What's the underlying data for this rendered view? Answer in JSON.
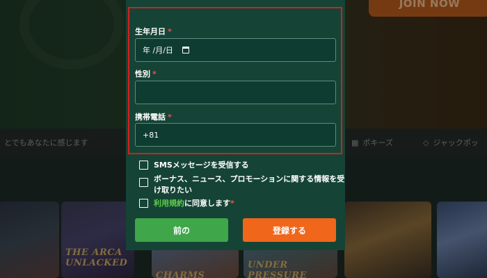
{
  "background": {
    "join_button": "JOIN NOW",
    "strip_left": "とでもあなたに感じます",
    "strip_poker": "ポキーズ",
    "strip_jackpot": "ジャックポッ",
    "tiles": [
      {
        "title": "THE ARCA UNLACKED"
      },
      {
        "title": "CHARMS"
      },
      {
        "title": "UNDER PRESSURE"
      }
    ]
  },
  "form": {
    "birthdate": {
      "label": "生年月日",
      "required_mark": "*",
      "value": "年 /月/日"
    },
    "gender": {
      "label": "性別",
      "required_mark": "*",
      "value": ""
    },
    "phone": {
      "label": "携帯電話",
      "required_mark": "*",
      "value": "+81"
    }
  },
  "checkboxes": {
    "sms": {
      "label": "SMSメッセージを受信する",
      "checked": false
    },
    "promo": {
      "line1": "ボーナス、ニュース、プロモーションに関する情報を受",
      "line2": "け取りたい",
      "checked": false
    },
    "terms": {
      "link": "利用規約",
      "text": "に同意します",
      "required_mark": "*",
      "checked": false
    }
  },
  "buttons": {
    "prev": "前の",
    "register": "登録する"
  },
  "colors": {
    "modal_bg": "#154436",
    "highlight_border": "#d81e1e",
    "prev_button": "#3fa64a",
    "register_button": "#f0661b",
    "terms_link": "#5fcf4b"
  }
}
